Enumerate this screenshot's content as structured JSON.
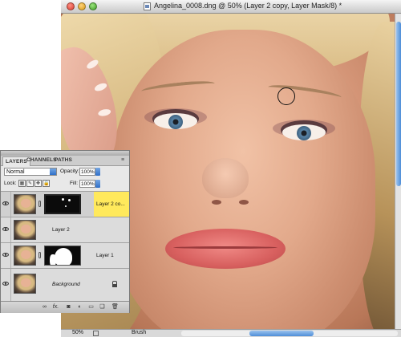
{
  "window": {
    "title": "Angelina_0008.dng @ 50% (Layer 2 copy, Layer Mask/8) *"
  },
  "status": {
    "zoom": "50%",
    "tool": "Brush"
  },
  "layers_panel": {
    "tabs": [
      "LAYERS",
      "CHANNELS",
      "PATHS"
    ],
    "active_tab": "LAYERS",
    "blend_mode": "Normal",
    "opacity_label": "Opacity:",
    "opacity_value": "100%",
    "lock_label": "Lock:",
    "fill_label": "Fill:",
    "fill_value": "100%",
    "layers": [
      {
        "name": "Layer 2 co...",
        "selected": true,
        "has_mask": true
      },
      {
        "name": "Layer 2",
        "selected": false,
        "has_mask": false
      },
      {
        "name": "Layer 1",
        "selected": false,
        "has_mask": true
      },
      {
        "name": "Background",
        "selected": false,
        "has_mask": false,
        "locked": true
      }
    ],
    "footer_icons": [
      "link-icon",
      "fx-icon",
      "mask-icon",
      "adjustment-icon",
      "group-icon",
      "new-layer-icon",
      "trash-icon"
    ]
  },
  "colors": {
    "selection_highlight": "#ffe95c",
    "scroll_accent": "#4e8ed8"
  }
}
